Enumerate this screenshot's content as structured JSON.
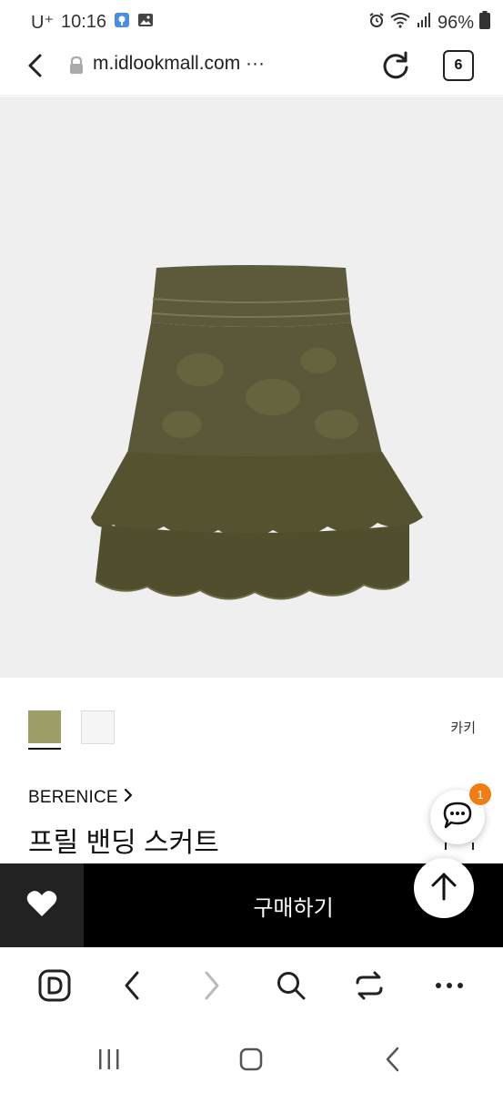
{
  "status_bar": {
    "carrier": "U⁺",
    "time": "10:16",
    "battery": "96%"
  },
  "browser": {
    "url": "m.idlookmall.com ···",
    "tab_count": "6"
  },
  "product": {
    "color_name": "카키",
    "swatches": [
      {
        "name": "khaki",
        "color": "#9d9f67",
        "selected": true
      },
      {
        "name": "white",
        "color": "#f5f5f5",
        "selected": false
      }
    ],
    "brand": "BERENICE",
    "title": "프릴 밴딩 스커트",
    "skirt_color": "#5a5838"
  },
  "purchase_bar": {
    "buy_label": "구매하기"
  },
  "chat": {
    "badge_count": "1"
  },
  "colors": {
    "accent_badge": "#f07d14",
    "purchase_bg": "#000000"
  }
}
